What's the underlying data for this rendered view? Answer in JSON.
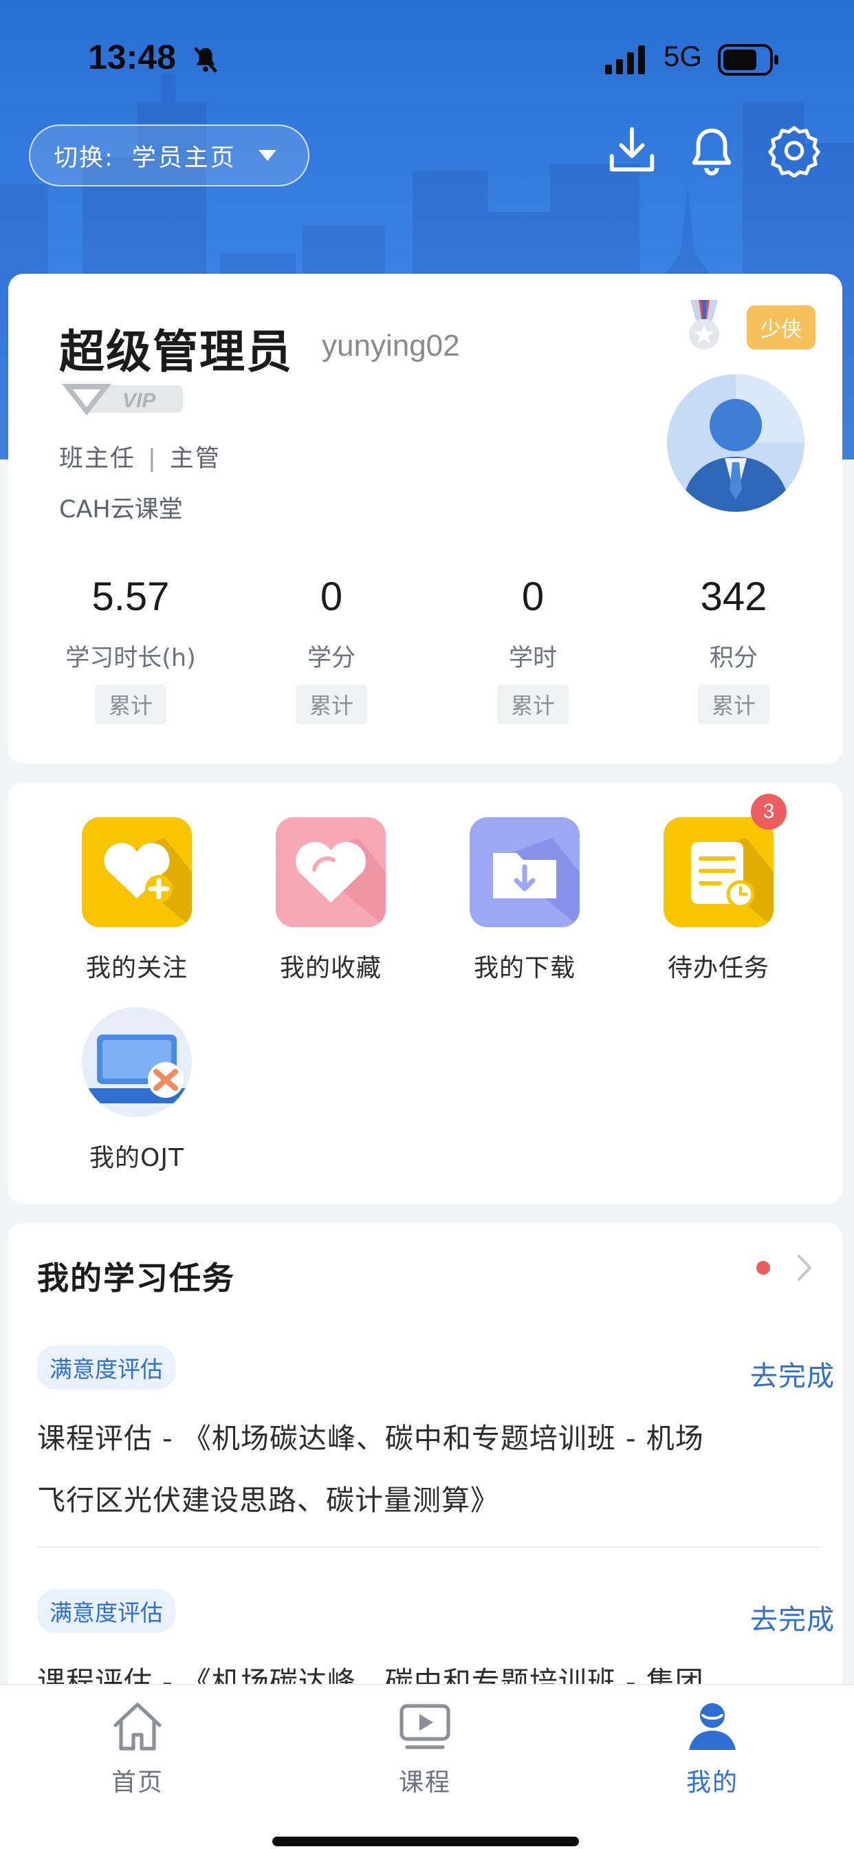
{
  "status_bar": {
    "time": "13:48",
    "network": "5G"
  },
  "header": {
    "switch_label": "切换:",
    "switch_value": "学员主页"
  },
  "profile": {
    "name": "超级管理员",
    "username": "yunying02",
    "vip_text": "VIP",
    "role_1": "班主任",
    "role_sep": "|",
    "role_2": "主管",
    "org": "CAH云课堂",
    "rank_badge": "少侠"
  },
  "stats": [
    {
      "value": "5.57",
      "label": "学习时长(h)",
      "tag": "累计"
    },
    {
      "value": "0",
      "label": "学分",
      "tag": "累计"
    },
    {
      "value": "0",
      "label": "学时",
      "tag": "累计"
    },
    {
      "value": "342",
      "label": "积分",
      "tag": "累计"
    }
  ],
  "menu": [
    {
      "label": "我的关注",
      "icon": "heart-plus-icon"
    },
    {
      "label": "我的收藏",
      "icon": "heart-icon"
    },
    {
      "label": "我的下载",
      "icon": "folder-download-icon"
    },
    {
      "label": "待办任务",
      "icon": "todo-document-icon",
      "badge": "3"
    },
    {
      "label": "我的OJT",
      "icon": "laptop-tools-icon"
    }
  ],
  "tasks": {
    "title": "我的学习任务",
    "items": [
      {
        "tag": "满意度评估",
        "action": "去完成",
        "line1": "课程评估 - 《机场碳达峰、碳中和专题培训班 - 机场",
        "line2": "飞行区光伏建设思路、碳计量测算》"
      },
      {
        "tag": "满意度评估",
        "action": "去完成",
        "line1": "课程评估 - 《机场碳达峰、碳中和专题培训班 - 集团",
        "line2": ""
      }
    ]
  },
  "tabbar": {
    "tabs": [
      {
        "label": "首页",
        "icon": "home-icon"
      },
      {
        "label": "课程",
        "icon": "play-screen-icon"
      },
      {
        "label": "我的",
        "icon": "person-icon",
        "active": true
      }
    ],
    "active_color": "#2d6fd2"
  },
  "colors": {
    "header_blue": "#2a6fd3",
    "accent": "#2d6fd2",
    "badge_red": "#ec5d5d",
    "rank_gold": "#f6c15b"
  }
}
